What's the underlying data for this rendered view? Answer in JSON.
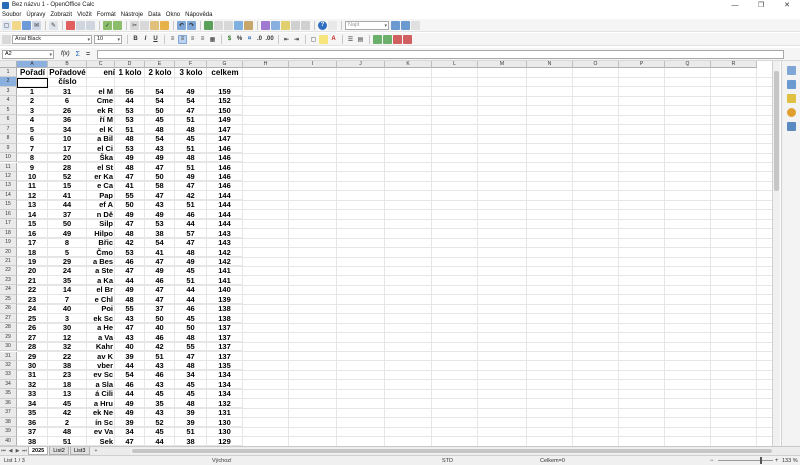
{
  "window": {
    "title": "Bez názvu 1 - OpenOffice Calc",
    "minimize": "—",
    "maximize": "❐",
    "close": "✕"
  },
  "menu": [
    "Soubor",
    "Úpravy",
    "Zobrazit",
    "Vložit",
    "Formát",
    "Nástroje",
    "Data",
    "Okno",
    "Nápověda"
  ],
  "toolbar": {
    "font_name": "Arial Black",
    "font_size": "10",
    "find_placeholder": "Najít",
    "bold": "B",
    "italic": "I",
    "underline": "U",
    "formula_fx": "f(x)",
    "formula_sum": "Σ",
    "formula_eq": "="
  },
  "namebox": {
    "value": "A2"
  },
  "columns": [
    "A",
    "B",
    "C",
    "D",
    "E",
    "F",
    "G",
    "H",
    "I",
    "J",
    "K",
    "L",
    "M",
    "N",
    "O",
    "P",
    "Q",
    "R"
  ],
  "header_row": {
    "A": "Pořadí",
    "B": "Pořadové číslo",
    "C": "ení",
    "D": "1 kolo",
    "E": "2 kolo",
    "F": "3 kolo",
    "G": "celkem"
  },
  "rows": [
    [
      "1",
      "31",
      "el M",
      "56",
      "54",
      "49",
      "159"
    ],
    [
      "2",
      "6",
      "Cme",
      "44",
      "54",
      "54",
      "152"
    ],
    [
      "3",
      "26",
      "ek R",
      "53",
      "50",
      "47",
      "150"
    ],
    [
      "4",
      "36",
      "ří M",
      "53",
      "45",
      "51",
      "149"
    ],
    [
      "5",
      "34",
      "el K",
      "51",
      "48",
      "48",
      "147"
    ],
    [
      "6",
      "10",
      "a Bil",
      "48",
      "54",
      "45",
      "147"
    ],
    [
      "7",
      "17",
      "el Ci",
      "53",
      "43",
      "51",
      "146"
    ],
    [
      "8",
      "20",
      "Ška",
      "49",
      "49",
      "48",
      "146"
    ],
    [
      "9",
      "28",
      "el St",
      "48",
      "47",
      "51",
      "146"
    ],
    [
      "10",
      "52",
      "er Ka",
      "47",
      "50",
      "49",
      "146"
    ],
    [
      "11",
      "15",
      "e Ca",
      "41",
      "58",
      "47",
      "146"
    ],
    [
      "12",
      "41",
      "Pap",
      "55",
      "47",
      "42",
      "144"
    ],
    [
      "13",
      "44",
      "ef A",
      "50",
      "43",
      "51",
      "144"
    ],
    [
      "14",
      "37",
      "n Dě",
      "49",
      "49",
      "46",
      "144"
    ],
    [
      "15",
      "50",
      "Silp",
      "47",
      "53",
      "44",
      "144"
    ],
    [
      "16",
      "49",
      "Hilpo",
      "48",
      "38",
      "57",
      "143"
    ],
    [
      "17",
      "8",
      "Břic",
      "42",
      "54",
      "47",
      "143"
    ],
    [
      "18",
      "5",
      "Čmo",
      "53",
      "41",
      "48",
      "142"
    ],
    [
      "19",
      "29",
      "a Bes",
      "46",
      "47",
      "49",
      "142"
    ],
    [
      "20",
      "24",
      "a Ste",
      "47",
      "49",
      "45",
      "141"
    ],
    [
      "21",
      "35",
      "a Ka",
      "44",
      "46",
      "51",
      "141"
    ],
    [
      "22",
      "14",
      "el Br",
      "49",
      "47",
      "44",
      "140"
    ],
    [
      "23",
      "7",
      "e Chl",
      "48",
      "47",
      "44",
      "139"
    ],
    [
      "24",
      "40",
      "Poi",
      "55",
      "37",
      "46",
      "138"
    ],
    [
      "25",
      "3",
      "ek Sc",
      "43",
      "50",
      "45",
      "138"
    ],
    [
      "26",
      "30",
      "a He",
      "47",
      "40",
      "50",
      "137"
    ],
    [
      "27",
      "12",
      "a Va",
      "43",
      "46",
      "48",
      "137"
    ],
    [
      "28",
      "32",
      "Kahr",
      "40",
      "42",
      "55",
      "137"
    ],
    [
      "29",
      "22",
      "av K",
      "39",
      "51",
      "47",
      "137"
    ],
    [
      "30",
      "38",
      "vber",
      "44",
      "43",
      "48",
      "135"
    ],
    [
      "31",
      "23",
      "ev Sc",
      "54",
      "46",
      "34",
      "134"
    ],
    [
      "32",
      "18",
      "a Sla",
      "46",
      "43",
      "45",
      "134"
    ],
    [
      "33",
      "13",
      "á Cili",
      "44",
      "45",
      "45",
      "134"
    ],
    [
      "34",
      "45",
      "a Hru",
      "49",
      "35",
      "48",
      "132"
    ],
    [
      "35",
      "42",
      "ek Ne",
      "49",
      "43",
      "39",
      "131"
    ],
    [
      "36",
      "2",
      "ín Sc",
      "39",
      "52",
      "39",
      "130"
    ],
    [
      "37",
      "48",
      "ev Va",
      "34",
      "45",
      "51",
      "130"
    ],
    [
      "38",
      "51",
      "Sek",
      "47",
      "44",
      "38",
      "129"
    ]
  ],
  "sheets": [
    "2025",
    "List2",
    "List3"
  ],
  "status": {
    "sheet": "List 1 / 3",
    "style": "Výchozí",
    "mode": "STD",
    "sum": "Celkem=0",
    "zoom": "133 %"
  }
}
